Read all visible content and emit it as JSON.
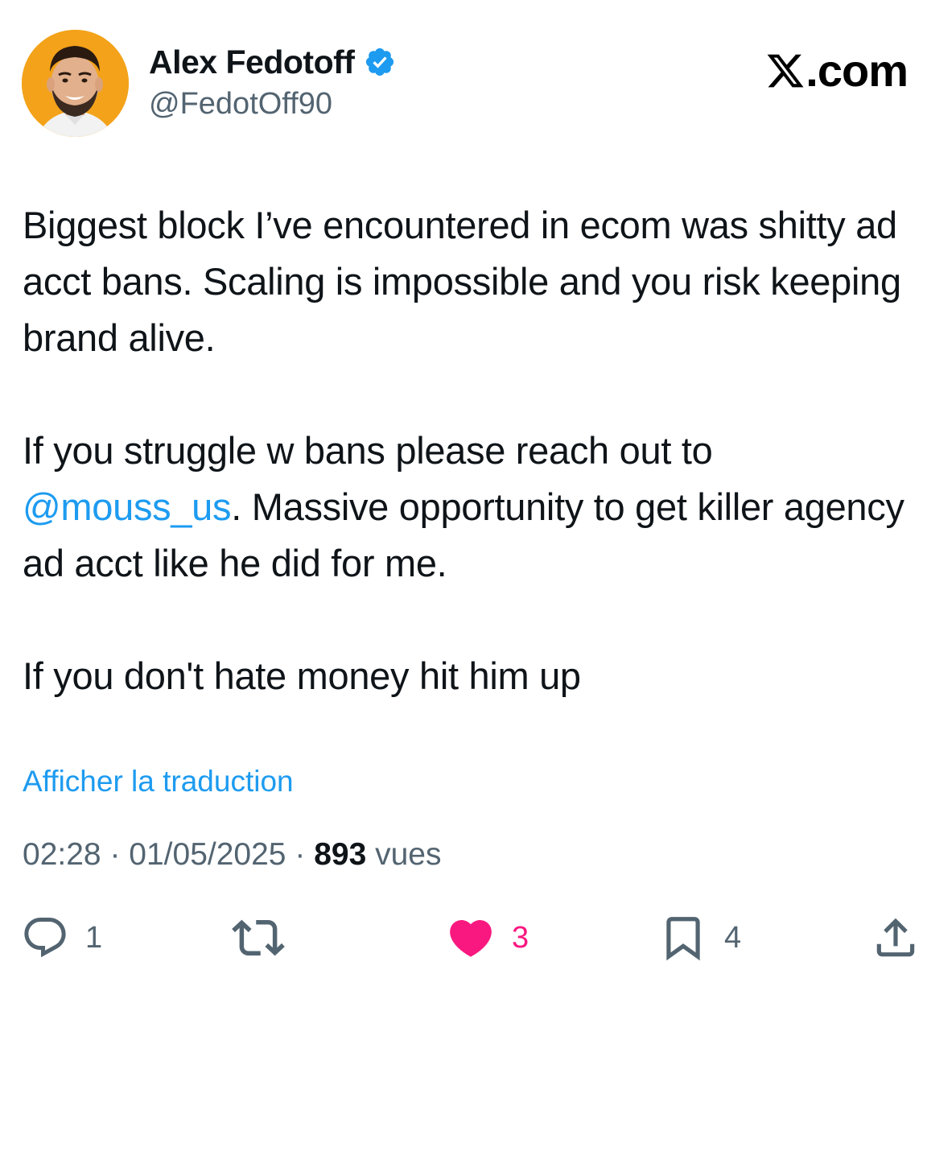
{
  "author": {
    "display_name": "Alex Fedotoff",
    "handle": "@FedotOff90",
    "verified": true,
    "avatar": "profile-photo"
  },
  "brand": {
    "text": ".com",
    "icon": "x-logo-icon"
  },
  "tweet": {
    "paragraphs": [
      "Biggest block I’ve encountered in ecom was shitty ad acct bans. Scaling is impossible and you risk keeping brand alive.",
      {
        "mention": "@mouss_us",
        "before": "If you struggle w bans please reach out to ",
        "after": ". Massive opportunity to get killer agency ad acct like he did for me."
      },
      "If you don't hate money hit him up"
    ]
  },
  "translate_link": "Afficher la traduction",
  "meta": {
    "time": "02:28",
    "separator": "·",
    "date": "01/05/2025",
    "views_count": "893",
    "views_label": "vues"
  },
  "actions": {
    "reply": {
      "icon": "reply-icon",
      "count": "1"
    },
    "retweet": {
      "icon": "retweet-icon",
      "count": ""
    },
    "like": {
      "icon": "heart-icon",
      "count": "3",
      "active": true
    },
    "bookmark": {
      "icon": "bookmark-icon",
      "count": "4"
    },
    "share": {
      "icon": "share-icon"
    }
  },
  "colors": {
    "accent": "#1d9bf0",
    "like": "#f91880",
    "secondary_text": "#536471",
    "primary_text": "#0f1419",
    "avatar_bg": "#f3a21a"
  }
}
